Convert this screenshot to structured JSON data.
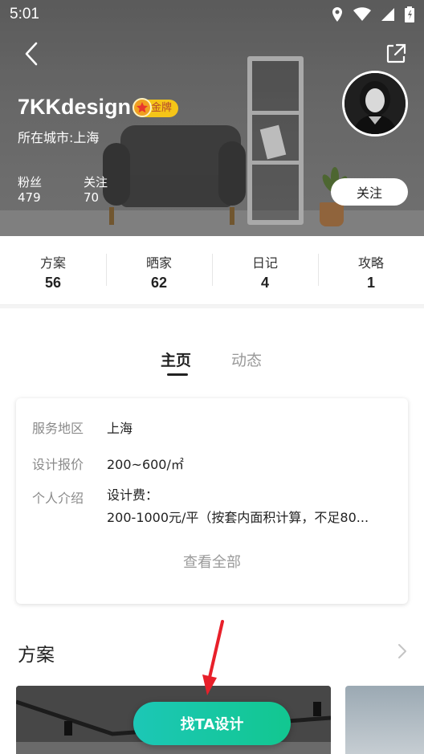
{
  "status_bar": {
    "time": "5:01",
    "icons": [
      "location-icon",
      "wifi-icon",
      "signal-icon",
      "battery-icon"
    ]
  },
  "header": {
    "name": "7KKdesign",
    "badge": "金牌",
    "city": "所在城市:上海",
    "fans_label": "粉丝",
    "fans_value": "479",
    "following_label": "关注",
    "following_value": "70",
    "follow_button": "关注"
  },
  "counts": [
    {
      "label": "方案",
      "value": "56"
    },
    {
      "label": "晒家",
      "value": "62"
    },
    {
      "label": "日记",
      "value": "4"
    },
    {
      "label": "攻略",
      "value": "1"
    }
  ],
  "tabs": [
    {
      "label": "主页",
      "active": true
    },
    {
      "label": "动态",
      "active": false
    }
  ],
  "info": {
    "area_label": "服务地区",
    "area_value": "上海",
    "price_label": "设计报价",
    "price_value": "200~600/㎡",
    "intro_label": "个人介绍",
    "intro_line1": "设计费：",
    "intro_line2": "200-1000元/平（按套内面积计算，不足80...",
    "see_all": "查看全部"
  },
  "section": {
    "title": "方案"
  },
  "cta": {
    "label": "找TA设计"
  },
  "colors": {
    "accent_green": "#12c790",
    "badge_gold": "#f5c518",
    "annotation_red": "#e8202a"
  }
}
